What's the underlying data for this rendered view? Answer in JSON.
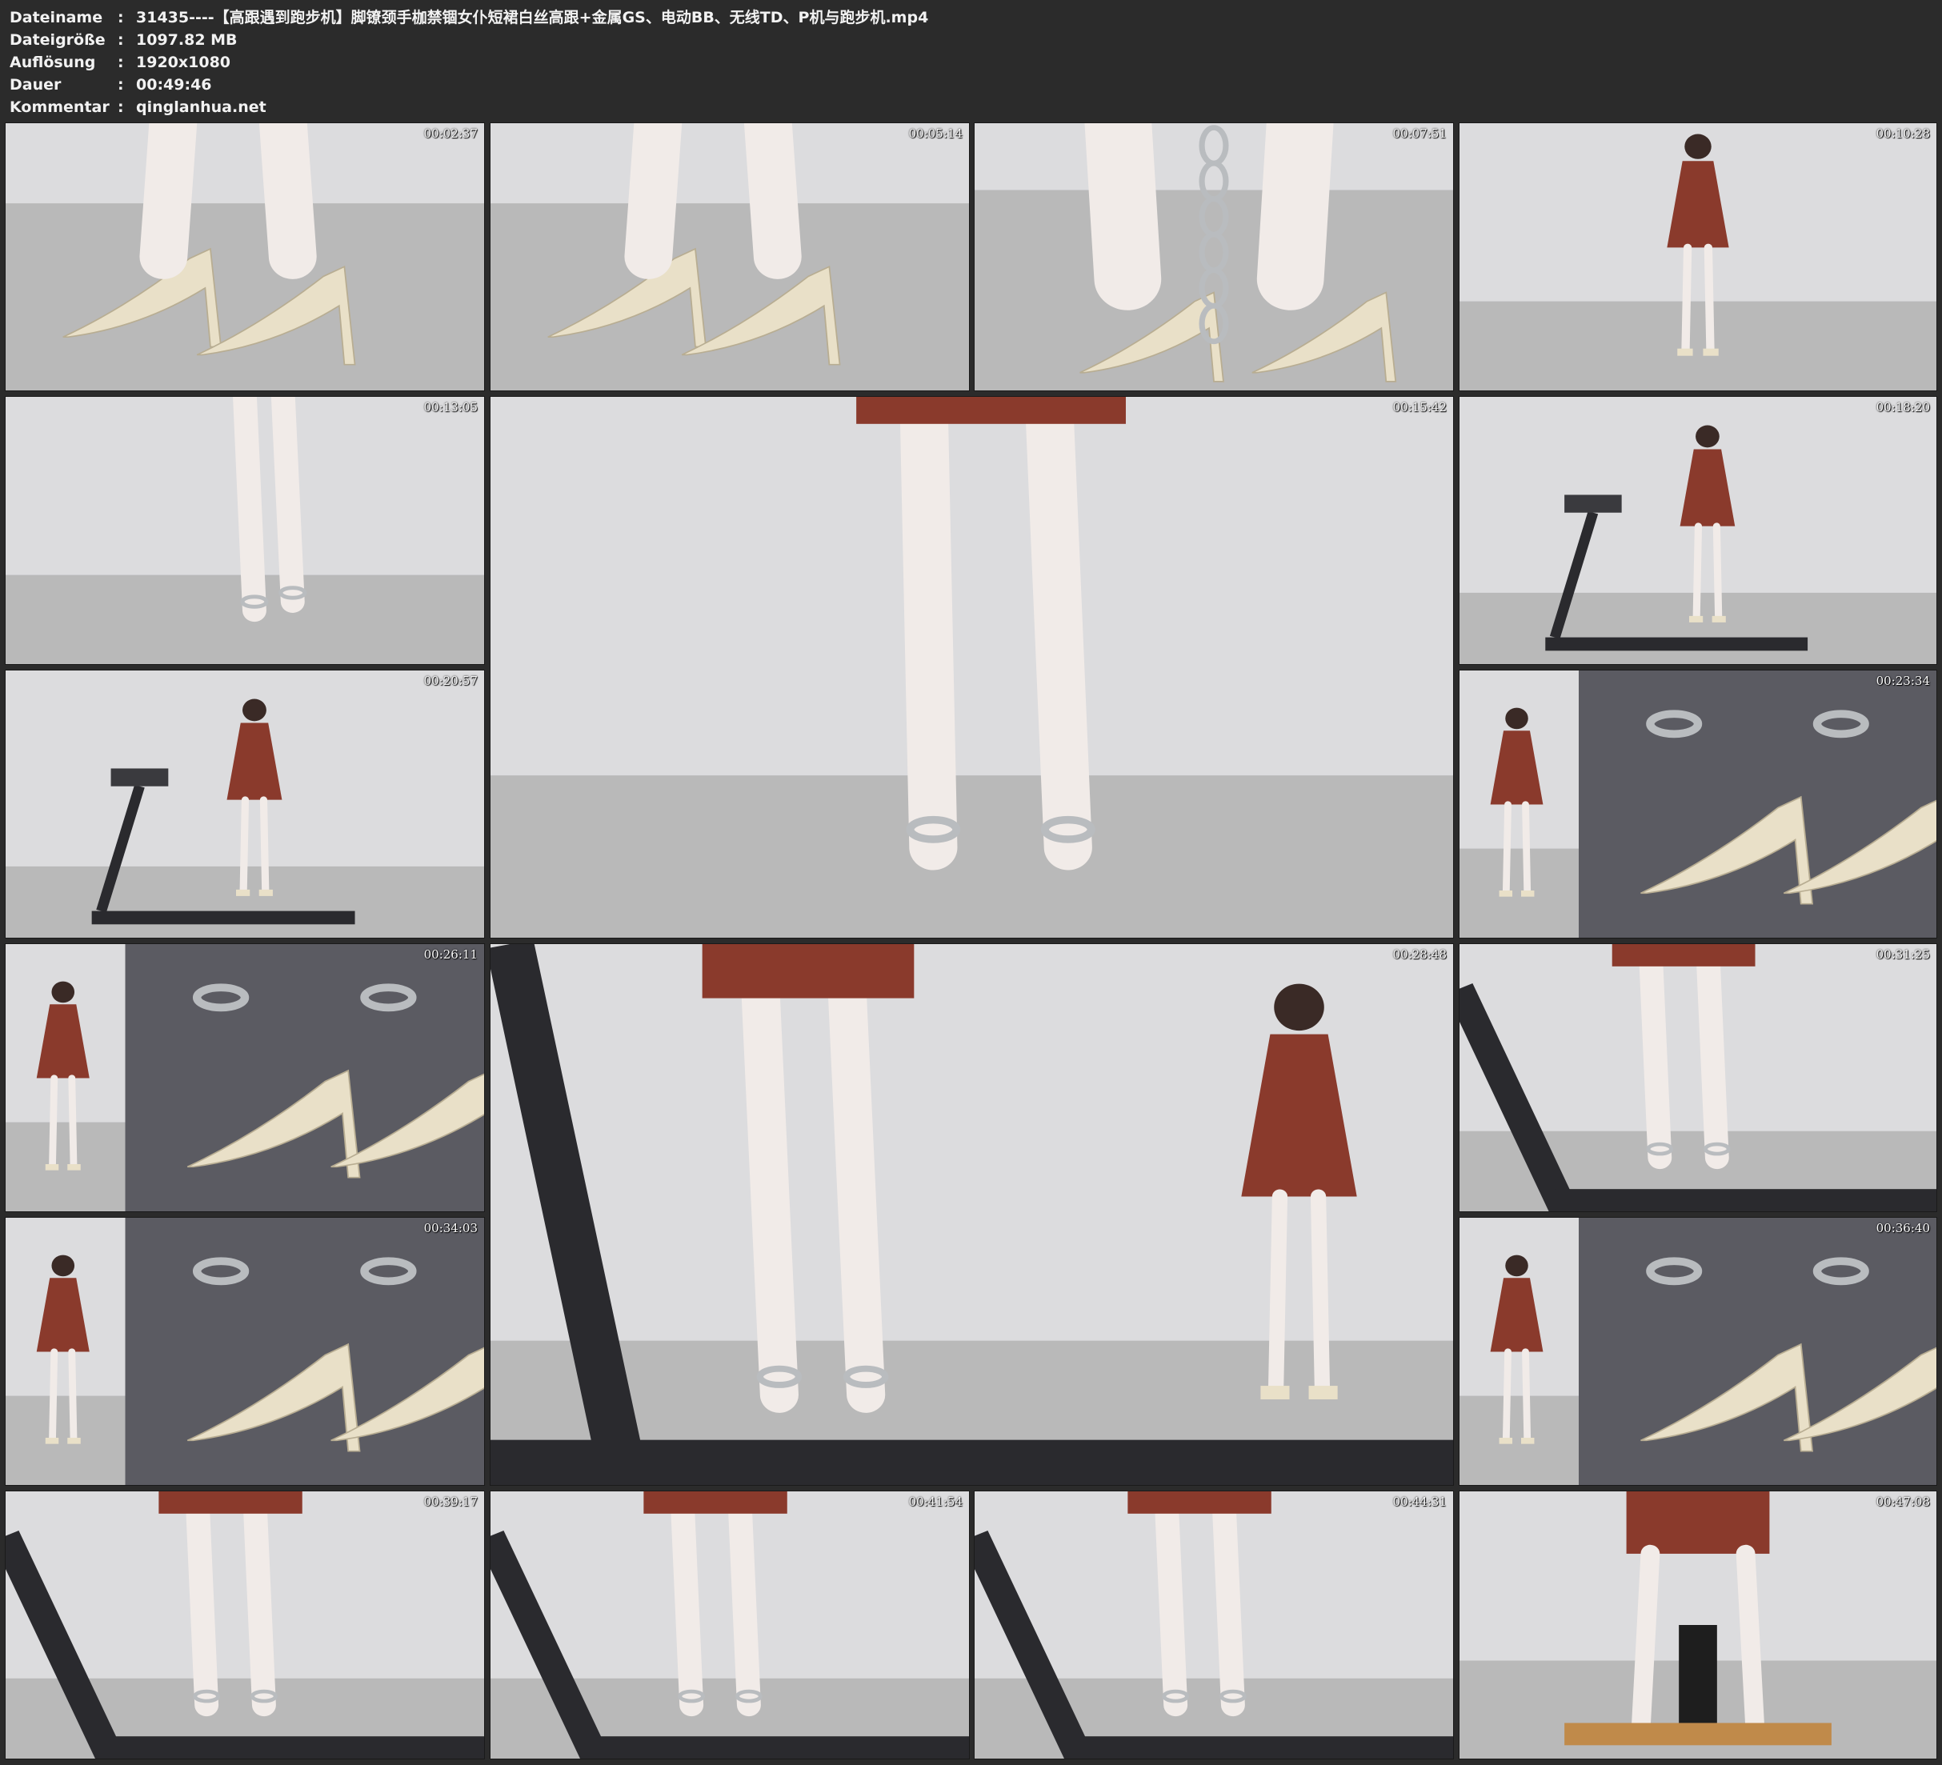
{
  "info": [
    {
      "label": "Dateiname",
      "value": "31435----【高跟遇到跑步机】脚镣颈手枷禁锢女仆短裙白丝高跟+金属GS、电动BB、无线TD、P机与跑步机.mp4"
    },
    {
      "label": "Dateigröße",
      "value": "1097.82 MB"
    },
    {
      "label": "Auflösung",
      "value": "1920x1080"
    },
    {
      "label": "Dauer",
      "value": "00:49:46"
    },
    {
      "label": "Kommentar",
      "value": "qinglanhua.net"
    }
  ],
  "colon": ":",
  "thumbnails": [
    {
      "timestamp": "00:02:37",
      "scene": "shoes-floor"
    },
    {
      "timestamp": "00:05:14",
      "scene": "shoes-floor"
    },
    {
      "timestamp": "00:07:51",
      "scene": "shoes-chain"
    },
    {
      "timestamp": "00:10:28",
      "scene": "standing-room"
    },
    {
      "timestamp": "00:13:05",
      "scene": "legs-room"
    },
    {
      "timestamp": "00:15:42",
      "scene": "legs-room-large"
    },
    {
      "timestamp": "00:18:20",
      "scene": "treadmill-standing"
    },
    {
      "timestamp": "00:20:57",
      "scene": "treadmill-standing"
    },
    {
      "timestamp": "00:23:34",
      "scene": "split-heels"
    },
    {
      "timestamp": "00:26:11",
      "scene": "split-heels"
    },
    {
      "timestamp": "00:28:48",
      "scene": "treadmill-legs-large"
    },
    {
      "timestamp": "00:31:25",
      "scene": "treadmill-legs"
    },
    {
      "timestamp": "00:34:03",
      "scene": "split-heels"
    },
    {
      "timestamp": "00:36:40",
      "scene": "split-heels"
    },
    {
      "timestamp": "00:39:17",
      "scene": "treadmill-legs"
    },
    {
      "timestamp": "00:41:54",
      "scene": "treadmill-legs"
    },
    {
      "timestamp": "00:44:31",
      "scene": "treadmill-legs"
    },
    {
      "timestamp": "00:47:08",
      "scene": "machine"
    }
  ],
  "colors": {
    "background": "#2b2b2b",
    "text": "#f2f2f2",
    "dress": "#8a3a2c",
    "stockings": "#f1ebe8",
    "shoes": "#e9e0c8",
    "metal": "#b9bcbf",
    "treadmill": "#2a2a2e",
    "wall": "#dcdcde",
    "floor": "#b9b9b9"
  }
}
